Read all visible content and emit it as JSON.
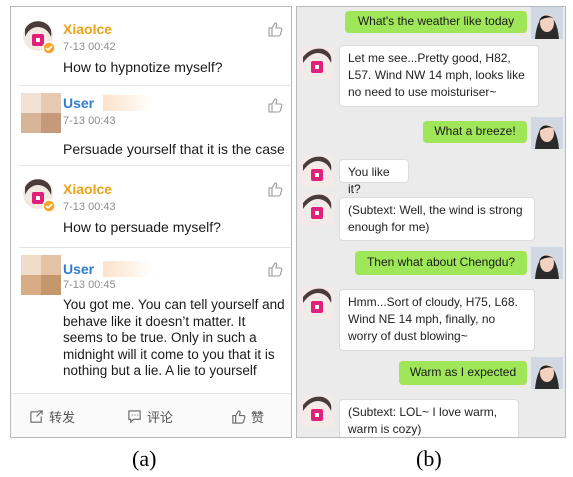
{
  "panel_a": {
    "comments": [
      {
        "name": "XiaoIce",
        "time": "7-13 00:42",
        "text": "How to hypnotize myself?"
      },
      {
        "name": "User",
        "time": "7-13 00:43",
        "text": "Persuade yourself that it is the case"
      },
      {
        "name": "XiaoIce",
        "time": "7-13 00:43",
        "text": "How to persuade myself?"
      },
      {
        "name": "User",
        "time": "7-13 00:45",
        "text": "You got me. You can tell yourself and behave like it doesn’t matter. It seems to be true. Only in such a midnight will it come to you that it is nothing but a lie. A lie to yourself"
      }
    ],
    "footer": {
      "repost": "转发",
      "comment": "评论",
      "like": "赞"
    }
  },
  "panel_b": {
    "messages": [
      {
        "from": "user",
        "text": "What's the weather like today"
      },
      {
        "from": "bot",
        "text": "Let me see...Pretty good, H82, L57. Wind NW 14 mph, looks like no need to use moisturiser~"
      },
      {
        "from": "user",
        "text": "What a breeze!"
      },
      {
        "from": "bot",
        "text": "You like it?"
      },
      {
        "from": "bot",
        "text": "(Subtext: Well, the wind is strong enough for me)"
      },
      {
        "from": "user",
        "text": "Then what about Chengdu?"
      },
      {
        "from": "bot",
        "text": "Hmm...Sort of cloudy, H75, L68. Wind NE 14 mph, finally, no worry of dust blowing~"
      },
      {
        "from": "user",
        "text": "Warm as I expected"
      },
      {
        "from": "bot",
        "text": "(Subtext: LOL~ I love warm, warm is cozy)"
      }
    ]
  },
  "captions": {
    "a": "(a)",
    "b": "(b)"
  },
  "colors": {
    "bot_name": "#e8a317",
    "user_name": "#2d7dd2",
    "user_bubble": "#9fe658",
    "chat_bg": "#ebebeb"
  }
}
